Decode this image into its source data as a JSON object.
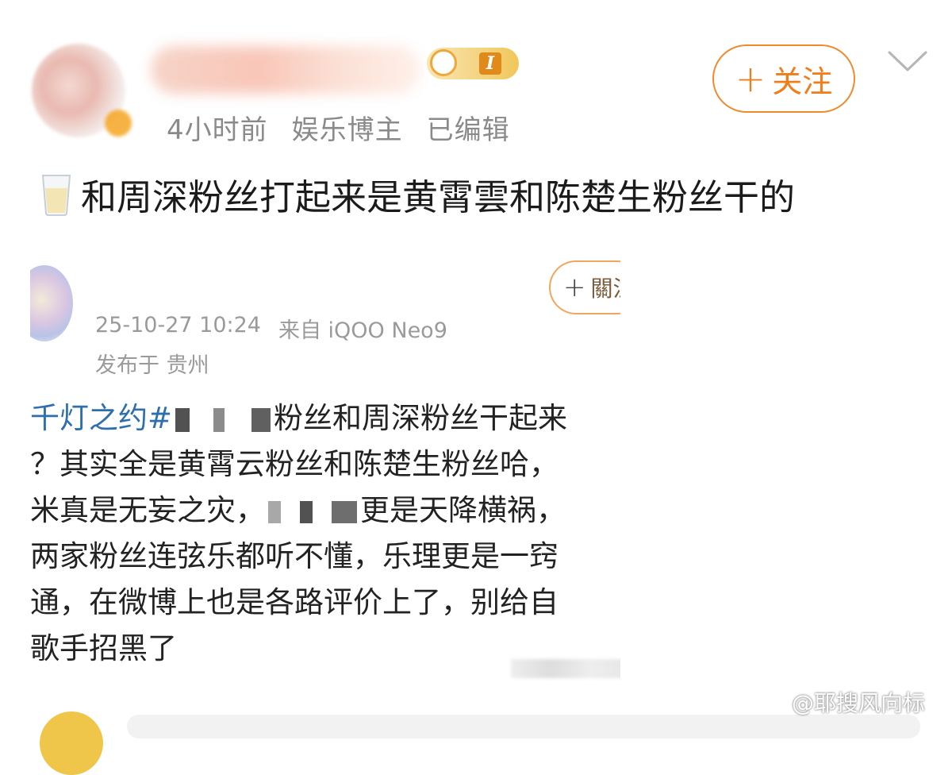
{
  "header": {
    "level_badge_text": "I",
    "meta": [
      "4小时前",
      "娱乐博主",
      "已编辑"
    ],
    "follow_label": "关注",
    "follow_plus": "+"
  },
  "post": {
    "text": "和周深粉丝打起来是黄霄雲和陈楚生粉丝干的",
    "icon": "milk-glass-icon"
  },
  "embedded_screenshot": {
    "follow_label": "關注",
    "follow_plus": "+",
    "date": "25-10-27 10:24",
    "source": "来自 iQOO Neo9",
    "location": "发布于 贵州",
    "lines": {
      "l1_hashtag": "千灯之约#",
      "l1_rest": "粉丝和周深粉丝干起来",
      "l2": "？其实全是黄霄云粉丝和陈楚生粉丝哈，",
      "l3_a": "米真是无妄之灾，",
      "l3_b": "更是天降横祸，",
      "l4": "两家粉丝连弦乐都听不懂，乐理更是一窍",
      "l5": "通，在微博上也是各路评价上了，别给自",
      "l6": "歌手招黑了"
    }
  },
  "watermark": {
    "text": "@耶搜风向标"
  },
  "colors": {
    "accent_orange": "#f07c1a",
    "meta_gray": "#8a8a8a",
    "hashtag_blue": "#2f6fae"
  }
}
